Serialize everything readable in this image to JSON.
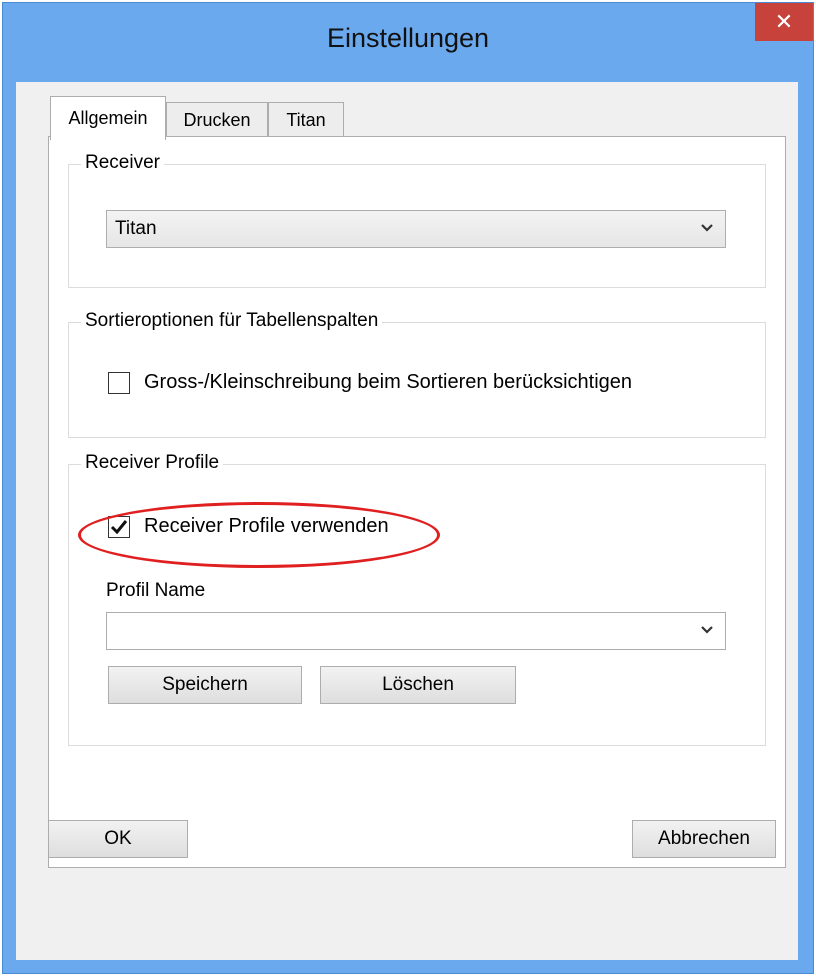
{
  "window": {
    "title": "Einstellungen",
    "close_glyph": "✕"
  },
  "tabs": [
    {
      "label": "Allgemein",
      "active": true
    },
    {
      "label": "Drucken",
      "active": false
    },
    {
      "label": "Titan",
      "active": false
    }
  ],
  "receiver_group": {
    "label": "Receiver",
    "selected": "Titan"
  },
  "sort_group": {
    "label": "Sortieroptionen für Tabellenspalten",
    "case_sensitive_label": "Gross-/Kleinschreibung beim Sortieren berücksichtigen",
    "case_sensitive_checked": false
  },
  "profile_group": {
    "label": "Receiver Profile",
    "use_profiles_label": "Receiver Profile verwenden",
    "use_profiles_checked": true,
    "profile_name_label": "Profil Name",
    "profile_name_value": "",
    "save_label": "Speichern",
    "delete_label": "Löschen"
  },
  "footer": {
    "ok_label": "OK",
    "cancel_label": "Abbrechen"
  },
  "colors": {
    "titlebar": "#6aa9ee",
    "close": "#c7423a",
    "highlight": "#e02020"
  },
  "icons": [
    "close-icon",
    "chevron-down-icon",
    "checkmark-icon"
  ]
}
